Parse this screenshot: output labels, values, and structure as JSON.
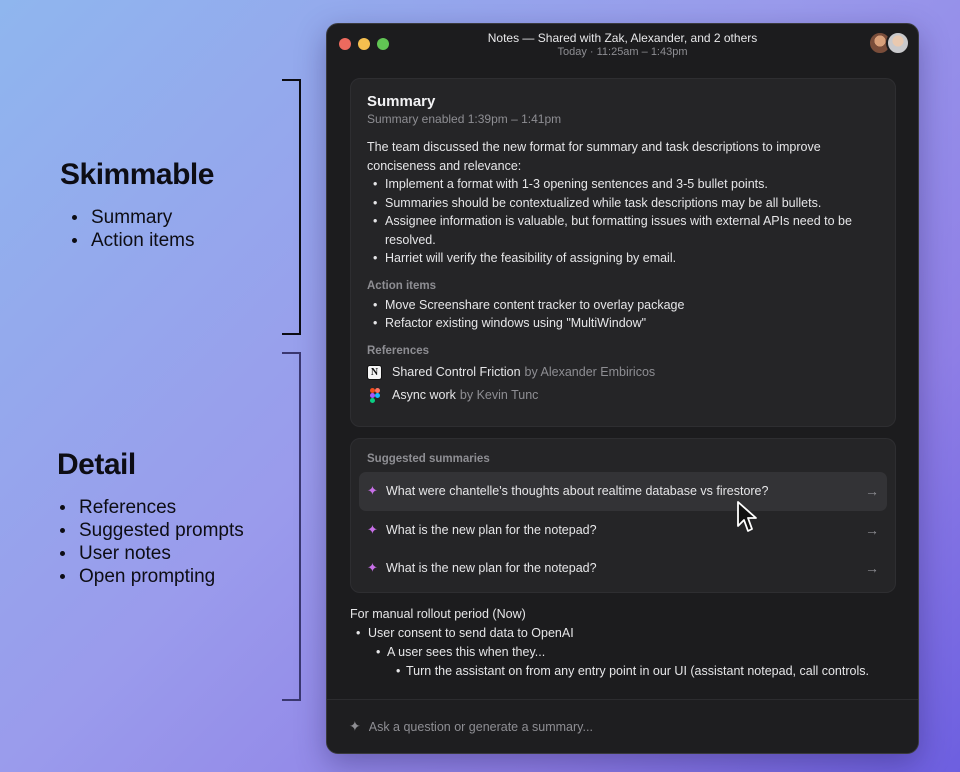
{
  "annotations": {
    "skimmable": {
      "heading": "Skimmable",
      "items": [
        "Summary",
        "Action items"
      ]
    },
    "detail": {
      "heading": "Detail",
      "items": [
        "References",
        "Suggested prompts",
        "User notes",
        "Open prompting"
      ]
    }
  },
  "window": {
    "title": "Notes — Shared with Zak, Alexander, and 2 others",
    "subtitle": "Today · 11:25am – 1:43pm"
  },
  "summary": {
    "heading": "Summary",
    "enabled": "Summary enabled 1:39pm – 1:41pm",
    "intro": "The team discussed the new format for summary and task descriptions to improve conciseness and relevance:",
    "bullets": [
      "Implement a format with 1-3 opening sentences and 3-5 bullet points.",
      "Summaries should be contextualized while task descriptions may be all bullets.",
      "Assignee information is valuable, but formatting issues with external APIs need to be resolved.",
      "Harriet will verify the feasibility of assigning by email."
    ],
    "action_label": "Action items",
    "actions": [
      "Move Screenshare content tracker to overlay package",
      "Refactor existing windows using \"MultiWindow\""
    ],
    "references_label": "References",
    "references": [
      {
        "title": "Shared Control Friction",
        "by": "by Alexander Embiricos",
        "icon": "notion-icon"
      },
      {
        "title": "Async work",
        "by": "by Kevin Tunc",
        "icon": "figma-icon"
      }
    ]
  },
  "suggested": {
    "label": "Suggested summaries",
    "items": [
      "What were chantelle's thoughts about realtime database vs firestore?",
      "What is the new plan for the notepad?",
      "What is the new plan for the notepad?"
    ]
  },
  "notes": {
    "heading": "For manual rollout period (Now)",
    "l1": "User consent to send data to OpenAI",
    "l2": "A user sees this when they...",
    "l3": "Turn the assistant on from any entry point in our UI (assistant notepad, call controls."
  },
  "composer": {
    "placeholder": "Ask a question or generate a summary..."
  }
}
